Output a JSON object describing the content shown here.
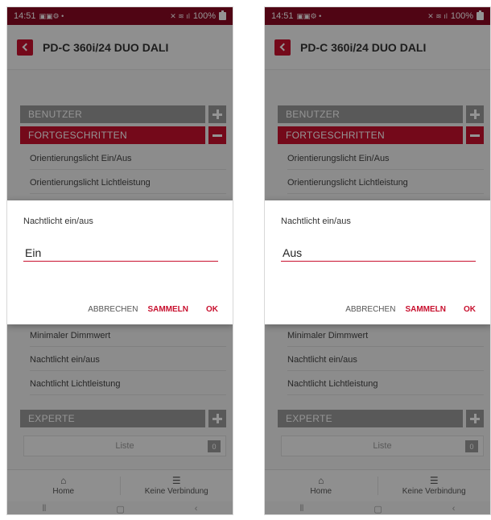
{
  "colors": {
    "brand": "#c8102e",
    "status_bar": "#8b0a24",
    "section_grey": "#9a9a9a"
  },
  "status_bar": {
    "time": "14:51",
    "battery": "100%"
  },
  "header": {
    "title": "PD-C 360i/24 DUO DALI"
  },
  "sections": {
    "benutzer": "BENUTZER",
    "fortgeschritten": "FORTGESCHRITTEN",
    "experte": "EXPERTE"
  },
  "menu": {
    "item_1": "Orientierungslicht Ein/Aus",
    "item_2": "Orientierungslicht Lichtleistung",
    "item_3": "Minimaler Dimmwert",
    "item_4": "Nachtlicht ein/aus",
    "item_5": "Nachtlicht Lichtleistung"
  },
  "list": {
    "label": "Liste",
    "count": "0"
  },
  "bottom_nav": {
    "home": "Home",
    "connection": "Keine Verbindung"
  },
  "dialog": {
    "title": "Nachtlicht ein/aus",
    "cancel_label": "ABBRECHEN",
    "collect_label": "SAMMELN",
    "ok_label": "OK"
  },
  "screens": [
    {
      "input_value": "Ein"
    },
    {
      "input_value": "Aus"
    }
  ]
}
